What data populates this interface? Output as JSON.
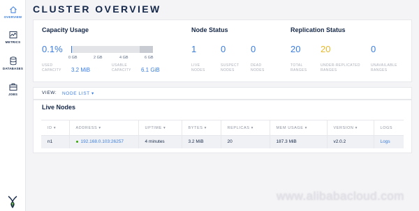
{
  "sidebar": {
    "items": [
      {
        "label": "OVERVIEW",
        "icon": "home-icon",
        "active": true
      },
      {
        "label": "METRICS",
        "icon": "metrics-icon"
      },
      {
        "label": "DATABASES",
        "icon": "database-icon"
      },
      {
        "label": "JOBS",
        "icon": "jobs-icon"
      }
    ]
  },
  "header": {
    "title": "CLUSTER OVERVIEW"
  },
  "capacity": {
    "heading": "Capacity Usage",
    "percent": "0.1%",
    "used_fraction": 0.001,
    "ticks": [
      "0 GB",
      "2 GB",
      "4 GB",
      "6 GB"
    ],
    "used_label": [
      "USED",
      "CAPACITY"
    ],
    "used_value": "3.2 MiB",
    "usable_label": [
      "USABLE",
      "CAPACITY"
    ],
    "usable_value": "6.1 GiB"
  },
  "node_status": {
    "heading": "Node Status",
    "live": "1",
    "live_label": [
      "LIVE",
      "NODES"
    ],
    "suspect": "0",
    "suspect_label": [
      "SUSPECT",
      "NODES"
    ],
    "dead": "0",
    "dead_label": [
      "DEAD",
      "NODES"
    ]
  },
  "replication": {
    "heading": "Replication Status",
    "total": "20",
    "total_label": [
      "TOTAL",
      "RANGES"
    ],
    "under": "20",
    "under_label": [
      "UNDER-REPLICATED",
      "RANGES"
    ],
    "unavailable": "0",
    "unavailable_label": [
      "UNAVAILABLE",
      "RANGES"
    ]
  },
  "view": {
    "label": "VIEW:",
    "value": "NODE LIST ▾"
  },
  "live_nodes": {
    "title": "Live Nodes",
    "columns": [
      "ID ▾",
      "ADDRESS ▾",
      "UPTIME ▾",
      "BYTES ▾",
      "REPLICAS ▾",
      "MEM USAGE ▾",
      "VERSION ▾",
      "LOGS"
    ],
    "rows": [
      [
        "n1",
        "192.168.0.103:26257",
        "4 minutes",
        "3.2 MiB",
        "20",
        "187.3 MiB",
        "v2.0.2",
        "Logs"
      ]
    ]
  },
  "watermark": "www.alibabacloud.com",
  "colors": {
    "accent": "#3a7de1",
    "warning": "#e5b82d",
    "live_dot": "#37a806",
    "text": "#152849"
  }
}
